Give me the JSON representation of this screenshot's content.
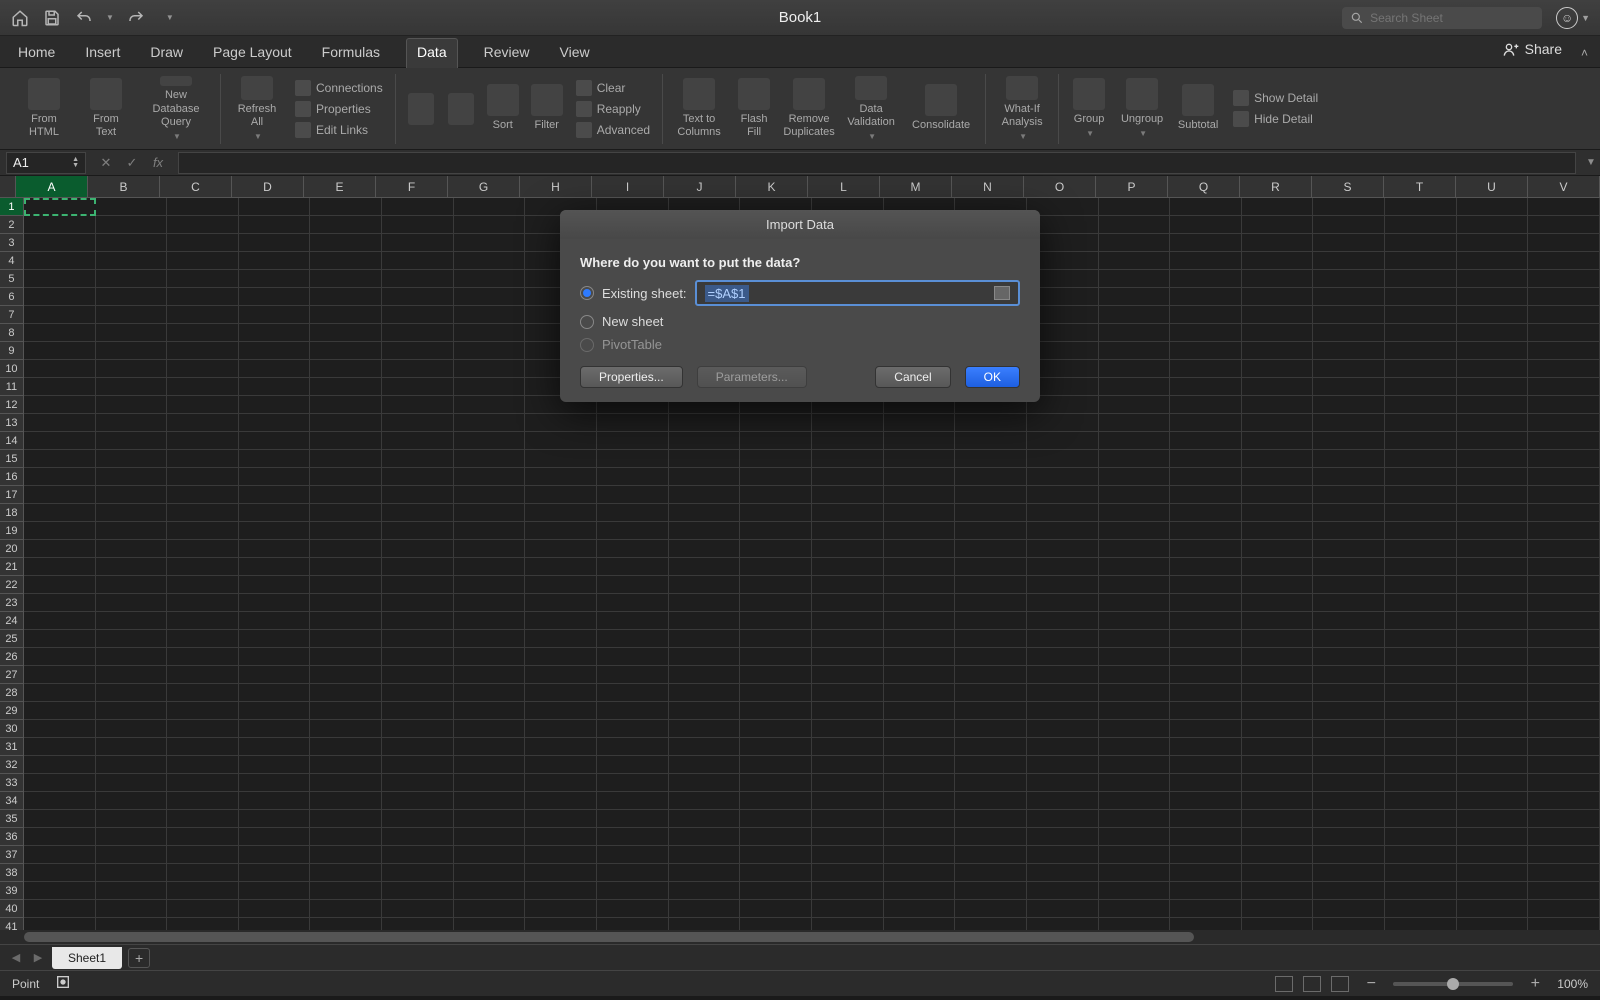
{
  "title": "Book1",
  "search_placeholder": "Search Sheet",
  "tabs": [
    "Home",
    "Insert",
    "Draw",
    "Page Layout",
    "Formulas",
    "Data",
    "Review",
    "View"
  ],
  "active_tab": "Data",
  "share_label": "Share",
  "ribbon": {
    "from_html": "From\nHTML",
    "from_text": "From\nText",
    "new_db_query": "New Database\nQuery",
    "refresh_all": "Refresh\nAll",
    "connections": "Connections",
    "properties": "Properties",
    "edit_links": "Edit Links",
    "sort": "Sort",
    "filter": "Filter",
    "clear": "Clear",
    "reapply": "Reapply",
    "advanced": "Advanced",
    "text_to_columns": "Text to\nColumns",
    "flash_fill": "Flash\nFill",
    "remove_duplicates": "Remove\nDuplicates",
    "data_validation": "Data\nValidation",
    "consolidate": "Consolidate",
    "whatif": "What-If\nAnalysis",
    "group": "Group",
    "ungroup": "Ungroup",
    "subtotal": "Subtotal",
    "show_detail": "Show Detail",
    "hide_detail": "Hide Detail"
  },
  "namebox_value": "A1",
  "columns": [
    "A",
    "B",
    "C",
    "D",
    "E",
    "F",
    "G",
    "H",
    "I",
    "J",
    "K",
    "L",
    "M",
    "N",
    "O",
    "P",
    "Q",
    "R",
    "S",
    "T",
    "U",
    "V"
  ],
  "rows": 42,
  "sheet_tabs": [
    "Sheet1"
  ],
  "status_mode": "Point",
  "zoom_label": "100%",
  "modal": {
    "title": "Import Data",
    "prompt": "Where do you want to put the data?",
    "opt_existing": "Existing sheet:",
    "opt_new": "New sheet",
    "opt_pivot": "PivotTable",
    "cell_value": "=$A$1",
    "btn_properties": "Properties...",
    "btn_parameters": "Parameters...",
    "btn_cancel": "Cancel",
    "btn_ok": "OK"
  }
}
